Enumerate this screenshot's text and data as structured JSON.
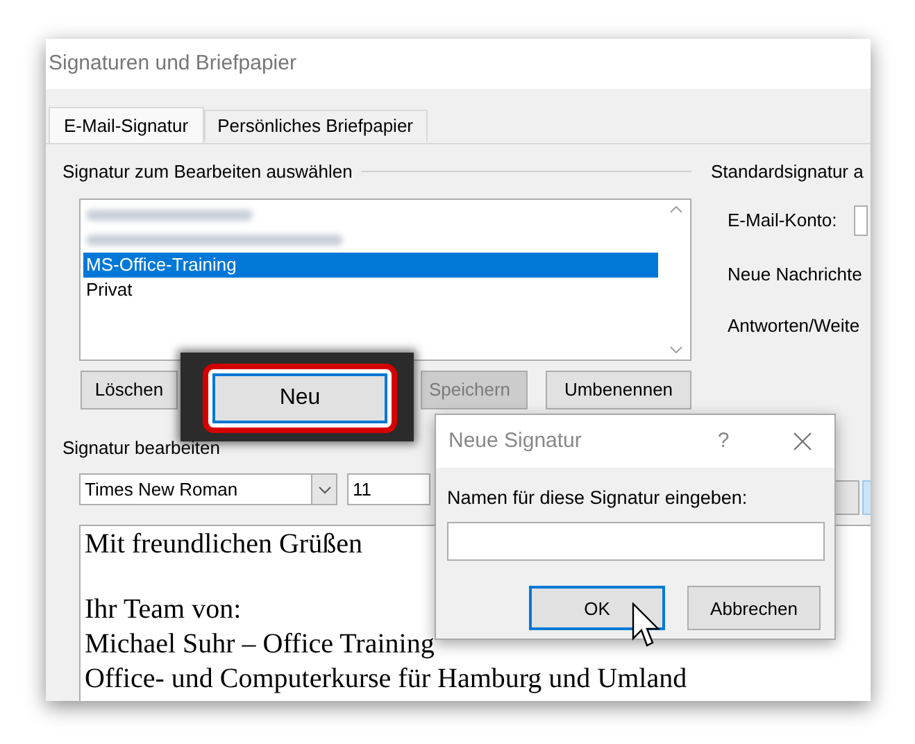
{
  "window": {
    "title": "Signaturen und Briefpapier"
  },
  "tabs": [
    {
      "label": "E-Mail-Signatur",
      "selected": true
    },
    {
      "label": "Persönliches Briefpapier",
      "selected": false
    }
  ],
  "select_group": {
    "label": "Signatur zum Bearbeiten auswählen",
    "signatures": [
      {
        "kind": "blurred",
        "selected": false
      },
      {
        "kind": "blurred",
        "selected": false
      },
      {
        "kind": "text",
        "label": "MS-Office-Training",
        "selected": true
      },
      {
        "kind": "text",
        "label": "Privat",
        "selected": false
      }
    ],
    "buttons": [
      {
        "label": "Löschen",
        "disabled": false,
        "highlighted": false
      },
      {
        "label": "Neu",
        "disabled": false,
        "highlighted": true
      },
      {
        "label": "Speichern",
        "disabled": true,
        "highlighted": false
      },
      {
        "label": "Umbenennen",
        "disabled": false,
        "highlighted": false
      }
    ]
  },
  "default_group": {
    "label": "Standardsignatur a",
    "fields": [
      "E-Mail-Konto:",
      "Neue Nachrichte",
      "Antworten/Weite"
    ]
  },
  "edit_group": {
    "label": "Signatur bearbeiten",
    "font": "Times New Roman",
    "size": "11",
    "paragraphs": [
      [
        "Mit freundlichen Grüßen"
      ],
      [
        "Ihr Team von:",
        "Michael Suhr – Office Training",
        "Office- und Computerkurse für Hamburg und Umland"
      ]
    ]
  },
  "dialog": {
    "title": "Neue Signatur",
    "help": "?",
    "prompt": "Namen für diese Signatur eingeben:",
    "buttons": [
      {
        "label": "OK",
        "default": true
      },
      {
        "label": "Abbrechen",
        "default": false
      }
    ]
  }
}
